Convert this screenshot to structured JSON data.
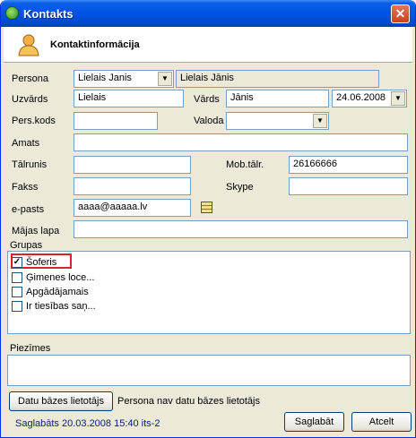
{
  "window": {
    "title": "Kontakts"
  },
  "header": {
    "title": "Kontaktinformācija"
  },
  "form": {
    "persona_label": "Persona",
    "persona_value": "Lielais Janis",
    "persona_display": "Lielais Jānis",
    "uzvards_label": "Uzvārds",
    "uzvards_value": "Lielais",
    "vards_label": "Vārds",
    "vards_value": "Jānis",
    "date_value": "24.06.2008",
    "perskods_label": "Pers.kods",
    "perskods_value": "",
    "valoda_label": "Valoda",
    "valoda_value": "",
    "amats_label": "Amats",
    "amats_value": "",
    "talrunis_label": "Tālrunis",
    "talrunis_value": "",
    "mobtalr_label": "Mob.tālr.",
    "mobtalr_value": "26166666",
    "fakss_label": "Fakss",
    "fakss_value": "",
    "skype_label": "Skype",
    "skype_value": "",
    "epasts_label": "e-pasts",
    "epasts_value": "aaaa@aaaaa.lv",
    "majaslapa_label": "Mājas lapa",
    "majaslapa_value": ""
  },
  "groups": {
    "label": "Grupas",
    "items": [
      {
        "label": "Šoferis",
        "checked": true
      },
      {
        "label": "Ģimenes loce...",
        "checked": false
      },
      {
        "label": "Apgādājamais",
        "checked": false
      },
      {
        "label": "Ir tiesības saņ...",
        "checked": false
      }
    ]
  },
  "notes": {
    "label": "Piezīmes",
    "value": ""
  },
  "footer": {
    "db_user_button": "Datu bāzes lietotājs",
    "db_user_status": "Persona nav datu bāzes lietotājs",
    "saved_status": "Saglabāts 20.03.2008 15:40 its-2",
    "save_button": "Saglabāt",
    "cancel_button": "Atcelt"
  },
  "icons": {
    "app": "app-icon",
    "close": "close-icon",
    "person": "person-icon",
    "email_grid": "address-book-icon"
  },
  "colors": {
    "titlebar": "#0054e3",
    "window_bg": "#ece9d8",
    "highlight": "#e0202a"
  }
}
